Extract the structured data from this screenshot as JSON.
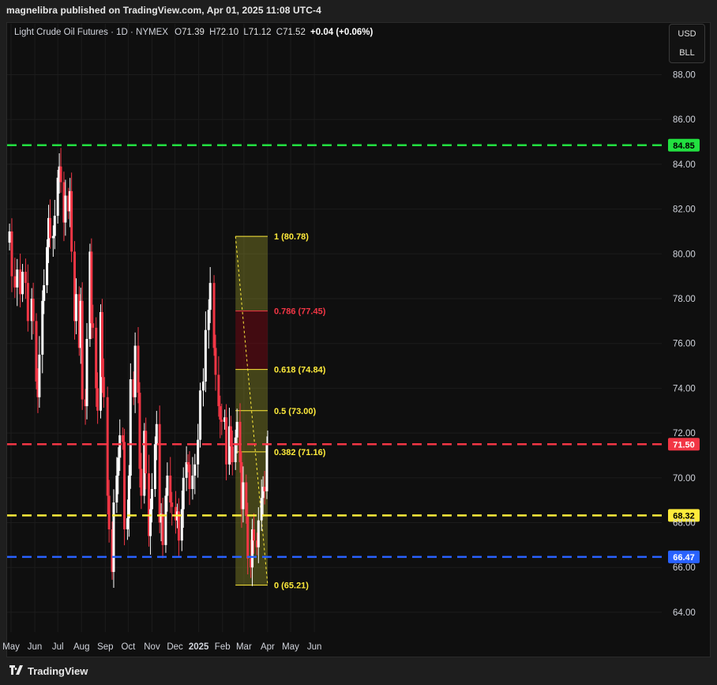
{
  "header": {
    "publish_line": "magnelibra published on TradingView.com, Apr 01, 2025 11:08 UTC-4"
  },
  "legend": {
    "symbol": "Light Crude Oil Futures · 1D · NYMEX",
    "o_label": "O",
    "o_value": "71.39",
    "h_label": "H",
    "h_value": "72.10",
    "l_label": "L",
    "l_value": "71.12",
    "c_label": "C",
    "c_value": "71.52",
    "change": "+0.04 (+0.06%)"
  },
  "currency": {
    "top": "USD",
    "bottom": "BLL"
  },
  "footer": {
    "brand": "TradingView"
  },
  "chart_data": {
    "type": "candlestick",
    "ylim": [
      63.0,
      90.0
    ],
    "y_ticks": [
      "88.00",
      "86.00",
      "84.00",
      "82.00",
      "80.00",
      "78.00",
      "76.00",
      "74.00",
      "72.00",
      "70.00",
      "68.00",
      "66.00",
      "64.00"
    ],
    "x_ticks": [
      "May",
      "Jun",
      "Jul",
      "Aug",
      "Sep",
      "Oct",
      "Nov",
      "Dec",
      "2025",
      "Feb",
      "Mar",
      "Apr",
      "May",
      "Jun"
    ],
    "bold_x_ticks": [
      "2025"
    ],
    "horizontal_levels": [
      {
        "value": 84.85,
        "label": "84.85",
        "color": "#22e040"
      },
      {
        "value": 71.5,
        "label": "71.50",
        "color": "#f23645"
      },
      {
        "value": 68.32,
        "label": "68.32",
        "color": "#ffeb3b"
      },
      {
        "value": 66.47,
        "label": "66.47",
        "color": "#2962ff"
      }
    ],
    "fib_retracement": {
      "from_date": "2025-02-18",
      "to_date": "2025-04-01",
      "levels": [
        {
          "ratio": "1",
          "price": 80.78,
          "text": "1 (80.78)",
          "color": "#ffeb3b"
        },
        {
          "ratio": "0.786",
          "price": 77.45,
          "text": "0.786 (77.45)",
          "color": "#f23645"
        },
        {
          "ratio": "0.618",
          "price": 74.84,
          "text": "0.618 (74.84)",
          "color": "#ffeb3b"
        },
        {
          "ratio": "0.5",
          "price": 73.0,
          "text": "0.5 (73.00)",
          "color": "#ffeb3b"
        },
        {
          "ratio": "0.382",
          "price": 71.16,
          "text": "0.382 (71.16)",
          "color": "#ffeb3b"
        },
        {
          "ratio": "0",
          "price": 65.21,
          "text": "0 (65.21)",
          "color": "#ffeb3b"
        }
      ]
    },
    "up_color": "#ffffff",
    "down_color": "#f23645",
    "series_close": [
      [
        "2024-04-29",
        81.0
      ],
      [
        "2024-05-02",
        79.0
      ],
      [
        "2024-05-06",
        78.5
      ],
      [
        "2024-05-09",
        79.3
      ],
      [
        "2024-05-13",
        78.2
      ],
      [
        "2024-05-16",
        79.2
      ],
      [
        "2024-05-20",
        78.7
      ],
      [
        "2024-05-23",
        77.0
      ],
      [
        "2024-05-28",
        78.0
      ],
      [
        "2024-05-30",
        77.0
      ],
      [
        "2024-06-03",
        74.3
      ],
      [
        "2024-06-05",
        73.6
      ],
      [
        "2024-06-07",
        75.5
      ],
      [
        "2024-06-11",
        77.9
      ],
      [
        "2024-06-13",
        78.6
      ],
      [
        "2024-06-17",
        80.3
      ],
      [
        "2024-06-19",
        81.6
      ],
      [
        "2024-06-21",
        80.7
      ],
      [
        "2024-06-25",
        80.8
      ],
      [
        "2024-06-27",
        81.7
      ],
      [
        "2024-07-01",
        83.4
      ],
      [
        "2024-07-03",
        83.9
      ],
      [
        "2024-07-05",
        83.2
      ],
      [
        "2024-07-09",
        81.4
      ],
      [
        "2024-07-11",
        82.6
      ],
      [
        "2024-07-15",
        81.9
      ],
      [
        "2024-07-17",
        82.8
      ],
      [
        "2024-07-19",
        80.1
      ],
      [
        "2024-07-23",
        77.0
      ],
      [
        "2024-07-25",
        78.2
      ],
      [
        "2024-07-29",
        75.8
      ],
      [
        "2024-07-31",
        77.9
      ],
      [
        "2024-08-02",
        73.5
      ],
      [
        "2024-08-06",
        73.2
      ],
      [
        "2024-08-08",
        76.2
      ],
      [
        "2024-08-12",
        80.1
      ],
      [
        "2024-08-14",
        76.9
      ],
      [
        "2024-08-16",
        76.7
      ],
      [
        "2024-08-20",
        74.0
      ],
      [
        "2024-08-22",
        73.0
      ],
      [
        "2024-08-26",
        77.4
      ],
      [
        "2024-08-28",
        74.5
      ],
      [
        "2024-08-30",
        73.6
      ],
      [
        "2024-09-04",
        69.2
      ],
      [
        "2024-09-06",
        67.7
      ],
      [
        "2024-09-10",
        65.8
      ],
      [
        "2024-09-12",
        68.9
      ],
      [
        "2024-09-16",
        70.1
      ],
      [
        "2024-09-18",
        70.9
      ],
      [
        "2024-09-20",
        71.9
      ],
      [
        "2024-09-24",
        71.6
      ],
      [
        "2024-09-26",
        67.7
      ],
      [
        "2024-09-30",
        68.2
      ],
      [
        "2024-10-02",
        70.1
      ],
      [
        "2024-10-04",
        74.4
      ],
      [
        "2024-10-08",
        73.6
      ],
      [
        "2024-10-10",
        75.9
      ],
      [
        "2024-10-14",
        73.8
      ],
      [
        "2024-10-16",
        70.4
      ],
      [
        "2024-10-18",
        69.2
      ],
      [
        "2024-10-22",
        72.1
      ],
      [
        "2024-10-24",
        70.2
      ],
      [
        "2024-10-28",
        67.4
      ],
      [
        "2024-10-30",
        68.6
      ],
      [
        "2024-11-01",
        69.5
      ],
      [
        "2024-11-05",
        71.5
      ],
      [
        "2024-11-07",
        72.4
      ],
      [
        "2024-11-11",
        68.0
      ],
      [
        "2024-11-13",
        68.4
      ],
      [
        "2024-11-15",
        67.0
      ],
      [
        "2024-11-19",
        69.2
      ],
      [
        "2024-11-21",
        70.1
      ],
      [
        "2024-11-25",
        68.9
      ],
      [
        "2024-11-27",
        68.7
      ],
      [
        "2024-12-02",
        68.1
      ],
      [
        "2024-12-04",
        68.5
      ],
      [
        "2024-12-06",
        67.2
      ],
      [
        "2024-12-10",
        68.6
      ],
      [
        "2024-12-12",
        70.0
      ],
      [
        "2024-12-16",
        70.7
      ],
      [
        "2024-12-18",
        70.6
      ],
      [
        "2024-12-20",
        69.5
      ],
      [
        "2024-12-24",
        70.1
      ],
      [
        "2024-12-27",
        70.6
      ],
      [
        "2024-12-31",
        71.7
      ],
      [
        "2025-01-03",
        73.9
      ],
      [
        "2025-01-07",
        74.3
      ],
      [
        "2025-01-10",
        76.6
      ],
      [
        "2025-01-14",
        77.5
      ],
      [
        "2025-01-16",
        78.7
      ],
      [
        "2025-01-21",
        75.8
      ],
      [
        "2025-01-23",
        74.6
      ],
      [
        "2025-01-27",
        73.2
      ],
      [
        "2025-01-29",
        72.6
      ],
      [
        "2025-01-31",
        72.5
      ],
      [
        "2025-02-04",
        72.7
      ],
      [
        "2025-02-06",
        70.6
      ],
      [
        "2025-02-10",
        72.3
      ],
      [
        "2025-02-12",
        71.4
      ],
      [
        "2025-02-14",
        70.7
      ],
      [
        "2025-02-18",
        71.8
      ],
      [
        "2025-02-20",
        72.5
      ],
      [
        "2025-02-24",
        70.7
      ],
      [
        "2025-02-26",
        68.6
      ],
      [
        "2025-02-28",
        69.8
      ],
      [
        "2025-03-04",
        68.3
      ],
      [
        "2025-03-06",
        66.4
      ],
      [
        "2025-03-10",
        66.0
      ],
      [
        "2025-03-12",
        67.7
      ],
      [
        "2025-03-14",
        67.2
      ],
      [
        "2025-03-18",
        66.9
      ],
      [
        "2025-03-20",
        68.1
      ],
      [
        "2025-03-24",
        69.1
      ],
      [
        "2025-03-26",
        69.6
      ],
      [
        "2025-03-28",
        69.4
      ],
      [
        "2025-03-31",
        71.5
      ],
      [
        "2025-04-01",
        71.52
      ]
    ]
  }
}
